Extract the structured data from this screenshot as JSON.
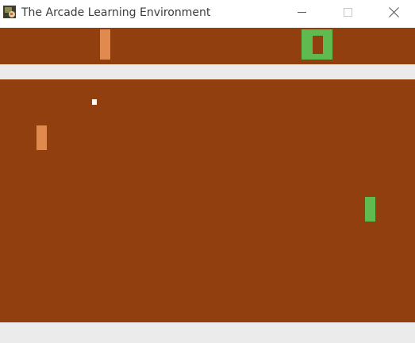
{
  "window": {
    "title": "The Arcade Learning Environment",
    "icon": "ale-app-icon",
    "controls": {
      "minimize_icon": "minimize-icon",
      "maximize_icon": "maximize-icon",
      "close_icon": "close-icon"
    }
  },
  "game": {
    "colors": {
      "field": "#913f0f",
      "bands": "#ebebeb",
      "left_player": "#e08a4f",
      "right_player": "#5fba4f",
      "ball": "#ffffff"
    },
    "scoreboard": {
      "left_digit_shape": "1",
      "right_digit_shape": "0"
    }
  }
}
